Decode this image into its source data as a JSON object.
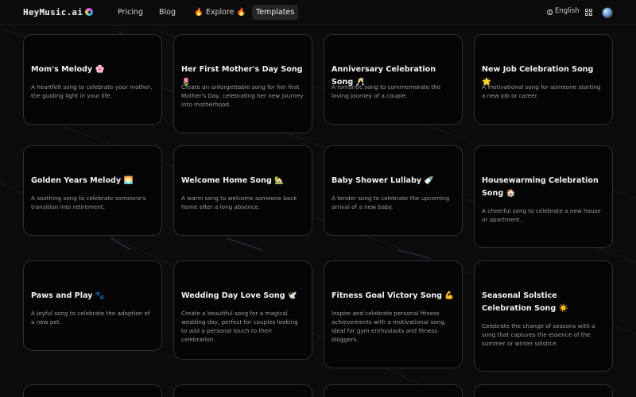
{
  "nav": {
    "logo": "HeyMusic.ai",
    "links": [
      "Pricing",
      "Blog",
      "🔥 Explore 🔥",
      "Templates"
    ],
    "language": "English"
  },
  "cards": [
    {
      "title": "Mom's Melody 🌸",
      "desc": "A heartfelt song to celebrate your mother, the guiding light in your life."
    },
    {
      "title": "Her First Mother's Day Song 🌷",
      "desc": "Create an unforgettable song for her first Mother's Day, celebrating her new journey into motherhood."
    },
    {
      "title": "Anniversary Celebration Song 🥂",
      "desc": "A romantic song to commemorate the loving journey of a couple."
    },
    {
      "title": "New Job Celebration Song 🌟",
      "desc": "A motivational song for someone starting a new job or career."
    },
    {
      "title": "Golden Years Melody 🌅",
      "desc": "A soothing song to celebrate someone's transition into retirement."
    },
    {
      "title": "Welcome Home Song 🏡",
      "desc": "A warm song to welcome someone back home after a long absence."
    },
    {
      "title": "Baby Shower Lullaby 🍼",
      "desc": "A tender song to celebrate the upcoming arrival of a new baby."
    },
    {
      "title": "Housewarming Celebration Song 🏠",
      "desc": "A cheerful song to celebrate a new house or apartment."
    },
    {
      "title": "Paws and Play 🐾",
      "desc": "A joyful song to celebrate the adoption of a new pet."
    },
    {
      "title": "Wedding Day Love Song 🕊️",
      "desc": "Create a beautiful song for a magical wedding day, perfect for couples looking to add a personal touch to their celebration."
    },
    {
      "title": "Fitness Goal Victory Song 💪",
      "desc": "Inspire and celebrate personal fitness achievements with a motivational song, ideal for gym enthusiasts and fitness bloggers."
    },
    {
      "title": "Seasonal Solstice Celebration Song ☀️",
      "desc": "Celebrate the change of seasons with a song that captures the essence of the summer or winter solstice."
    }
  ]
}
